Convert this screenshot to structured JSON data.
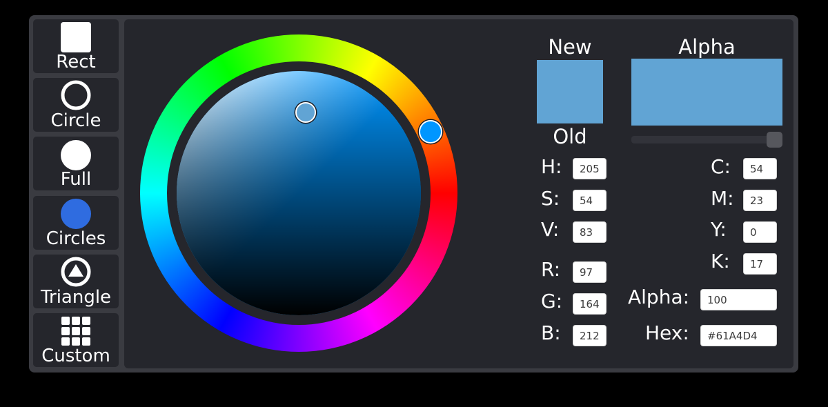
{
  "sidebar": {
    "items": [
      {
        "label": "Rect",
        "icon": "square-icon"
      },
      {
        "label": "Circle",
        "icon": "ring-icon"
      },
      {
        "label": "Full",
        "icon": "filled-circle-icon"
      },
      {
        "label": "Circles",
        "icon": "blue-circle-icon"
      },
      {
        "label": "Triangle",
        "icon": "triangle-in-circle-icon"
      },
      {
        "label": "Custom",
        "icon": "grid-icon"
      }
    ]
  },
  "preview": {
    "new_label": "New",
    "old_label": "Old",
    "alpha_label": "Alpha",
    "new_color": "#61A4D4",
    "old_color": "#61A4D4",
    "alpha_color": "#61A4D4",
    "alpha_slider_level": 1.0
  },
  "fields": {
    "h": {
      "label": "H:",
      "value": "205"
    },
    "s": {
      "label": "S:",
      "value": "54"
    },
    "v": {
      "label": "V:",
      "value": "83"
    },
    "r": {
      "label": "R:",
      "value": "97"
    },
    "g": {
      "label": "G:",
      "value": "164"
    },
    "b": {
      "label": "B:",
      "value": "212"
    },
    "c": {
      "label": "C:",
      "value": "54"
    },
    "m": {
      "label": "M:",
      "value": "23"
    },
    "y": {
      "label": "Y:",
      "value": "0"
    },
    "k": {
      "label": "K:",
      "value": "17"
    },
    "alpha": {
      "label": "Alpha:",
      "value": "100"
    },
    "hex": {
      "label": "Hex:",
      "value": "#61A4D4"
    }
  },
  "colors": {
    "panel_bg": "#3a3b41",
    "control_bg": "#25262c",
    "selected_color": "#61A4D4",
    "hue_color": "#0096ff",
    "circles_icon": "#2f6ce0"
  }
}
